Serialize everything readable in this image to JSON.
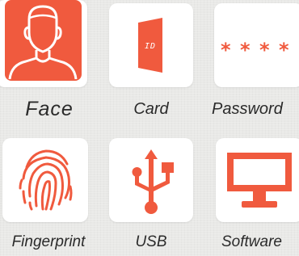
{
  "accent_color": "#f05a3e",
  "tiles": [
    {
      "label": "Face",
      "icon": "face-icon"
    },
    {
      "label": "Card",
      "icon": "id-card-icon",
      "icon_text": "ID"
    },
    {
      "label": "Password",
      "icon": "password-asterisks-icon"
    },
    {
      "label": "Fingerprint",
      "icon": "fingerprint-icon"
    },
    {
      "label": "USB",
      "icon": "usb-icon"
    },
    {
      "label": "Software",
      "icon": "monitor-icon"
    }
  ]
}
